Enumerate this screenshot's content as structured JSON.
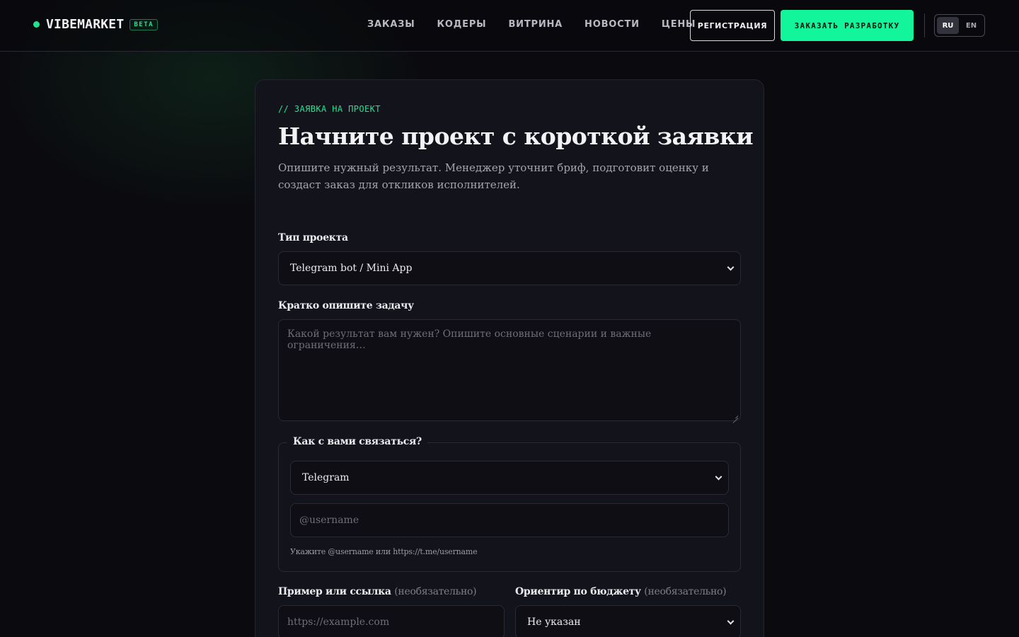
{
  "header": {
    "logo": "VIBEMARKET",
    "badge": "BETA",
    "nav": [
      "ЗАКАЗЫ",
      "КОДЕРЫ",
      "ВИТРИНА",
      "НОВОСТИ",
      "ЦЕНЫ"
    ],
    "register_label": "РЕГИСТРАЦИЯ",
    "order_label": "ЗАКАЗАТЬ РАЗРАБОТКУ",
    "languages": [
      "RU",
      "EN"
    ],
    "active_language": "RU"
  },
  "form": {
    "eyebrow": "// ЗАЯВКА НА ПРОЕКТ",
    "title": "Начните проект с короткой заявки",
    "subtitle": "Опишите нужный результат. Менеджер уточнит бриф, подготовит оценку и создаст заказ для откликов исполнителей.",
    "project_type": {
      "label": "Тип проекта",
      "value": "Telegram bot / Mini App"
    },
    "task": {
      "label": "Кратко опишите задачу",
      "placeholder": "Какой результат вам нужен? Опишите основные сценарии и важные ограничения…"
    },
    "contact": {
      "legend": "Как с вами связаться?",
      "method": "Telegram",
      "placeholder": "@username",
      "hint": "Укажите @username или https://t.me/username"
    },
    "example": {
      "label": "Пример или ссылка",
      "optional": "(необязательно)",
      "placeholder": "https://example.com"
    },
    "budget": {
      "label": "Ориентир по бюджету",
      "optional": "(необязательно)",
      "value": "Не указан"
    }
  },
  "colors": {
    "accent": "#12f59a",
    "background": "#0b0b0f",
    "card": "#13131b"
  }
}
